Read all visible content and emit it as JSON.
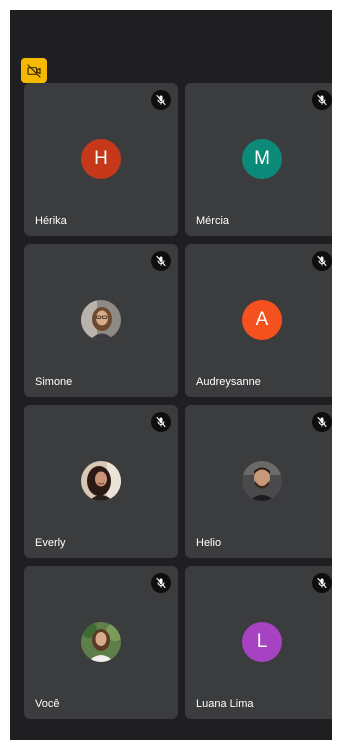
{
  "colors": {
    "screen_background": "#1f1f21",
    "tile_background": "#3b3c3e",
    "camera_badge": "#f6b900",
    "mute_badge": "#0e0e0f"
  },
  "camera_badge": {
    "icon": "video-off-icon"
  },
  "participants": [
    {
      "name": "Hérika",
      "initial": "H",
      "avatar_type": "initial",
      "avatar_color": "#c5391a",
      "muted": true,
      "mute_icon": "mic-off-icon"
    },
    {
      "name": "Mércia",
      "initial": "M",
      "avatar_type": "initial",
      "avatar_color": "#0b8a7a",
      "muted": true,
      "mute_icon": "mic-off-icon"
    },
    {
      "name": "Simone",
      "avatar_type": "photo",
      "muted": true,
      "mute_icon": "mic-off-icon"
    },
    {
      "name": "Audreysanne",
      "initial": "A",
      "avatar_type": "initial",
      "avatar_color": "#f4511e",
      "muted": true,
      "mute_icon": "mic-off-icon"
    },
    {
      "name": "Everly",
      "avatar_type": "photo",
      "muted": true,
      "mute_icon": "mic-off-icon"
    },
    {
      "name": "Helio",
      "avatar_type": "photo",
      "muted": true,
      "mute_icon": "mic-off-icon"
    },
    {
      "name": "Você",
      "avatar_type": "photo",
      "muted": true,
      "mute_icon": "mic-off-icon"
    },
    {
      "name": "Luana Lima",
      "initial": "L",
      "avatar_type": "initial",
      "avatar_color": "#a742c2",
      "muted": true,
      "mute_icon": "mic-off-icon"
    }
  ]
}
